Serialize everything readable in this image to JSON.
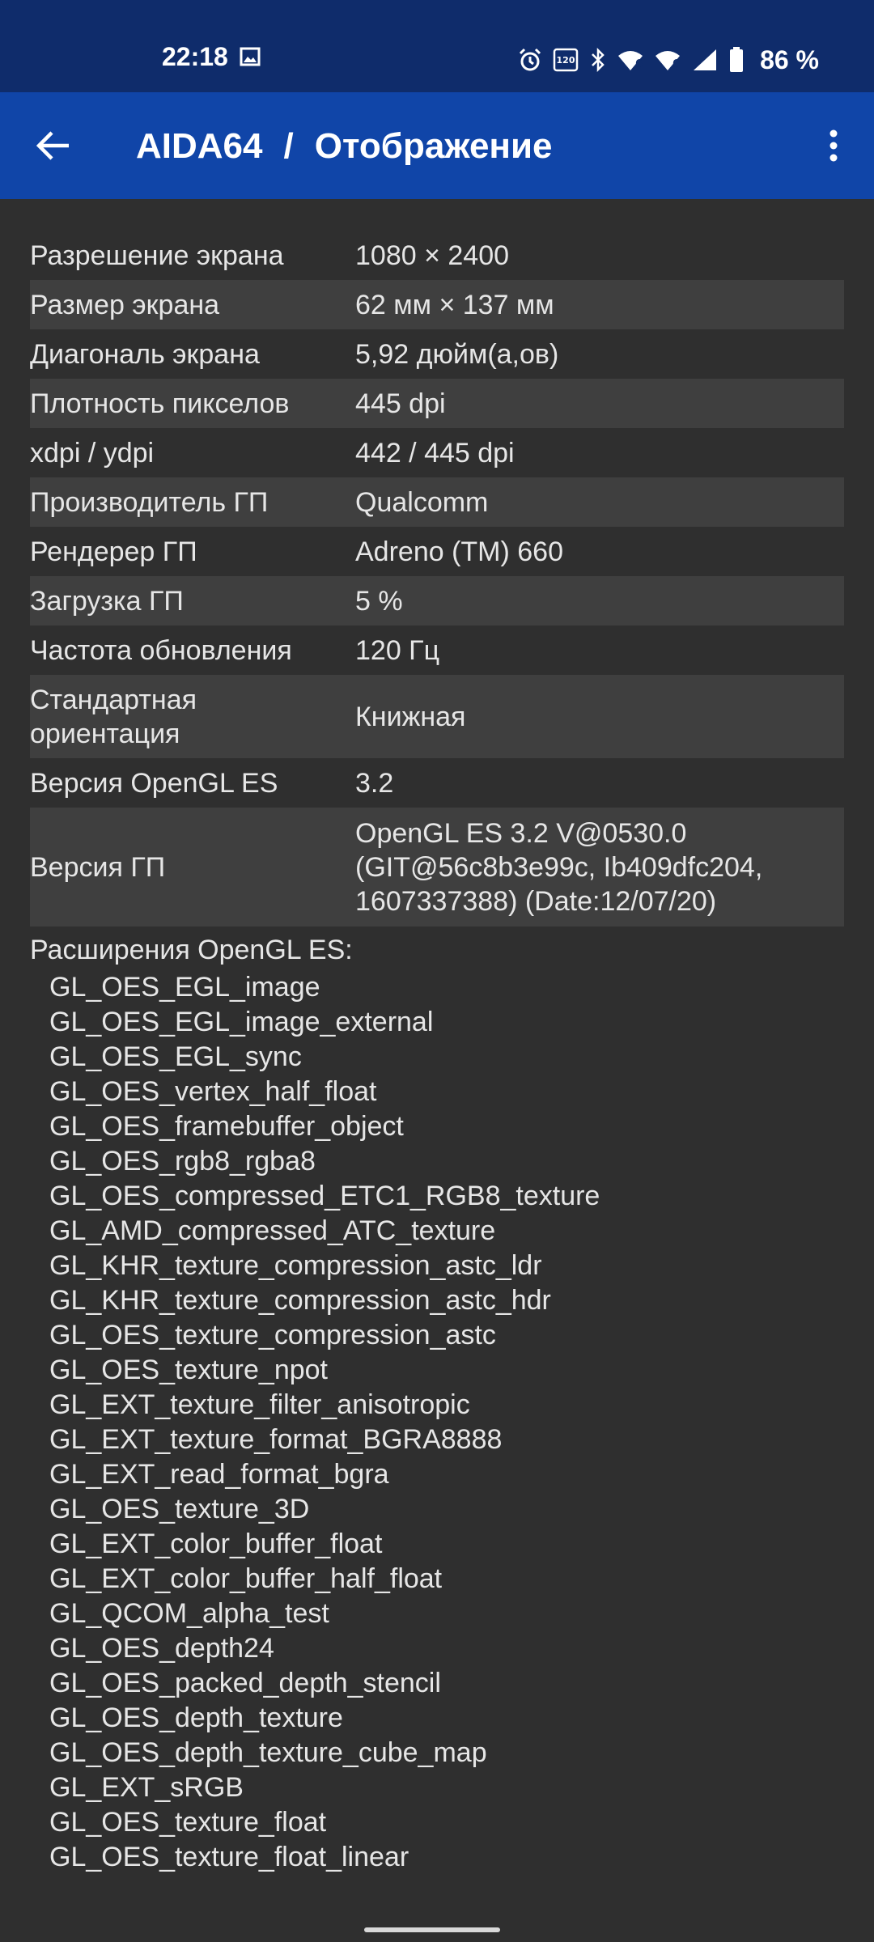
{
  "status_bar": {
    "time": "22:18",
    "battery_percent": "86 %",
    "refresh_badge": "120",
    "icons": [
      "image-icon",
      "alarm-icon",
      "refresh-rate-icon",
      "bluetooth-icon",
      "wifi-6-icon",
      "wifi-6-icon",
      "signal-icon",
      "battery-icon"
    ]
  },
  "app_bar": {
    "app_name": "AIDA64",
    "separator": "/",
    "page_title": "Отображение",
    "back_icon": "arrow-back-icon",
    "menu_icon": "more-vert-icon"
  },
  "rows": [
    {
      "label": "Разрешение экрана",
      "value": "1080 × 2400"
    },
    {
      "label": "Размер экрана",
      "value": "62 мм × 137 мм"
    },
    {
      "label": "Диагональ экрана",
      "value": "5,92 дюйм(а,ов)"
    },
    {
      "label": "Плотность пикселов",
      "value": "445 dpi"
    },
    {
      "label": "xdpi / ydpi",
      "value": "442 / 445 dpi"
    },
    {
      "label": "Производитель ГП",
      "value": "Qualcomm"
    },
    {
      "label": "Рендерер ГП",
      "value": "Adreno (TM) 660"
    },
    {
      "label": "Загрузка ГП",
      "value": "5 %"
    },
    {
      "label": "Частота обновления",
      "value": "120 Гц"
    },
    {
      "label": "Стандартная ориентация",
      "value": "Книжная"
    },
    {
      "label": "Версия OpenGL ES",
      "value": "3.2"
    },
    {
      "label": "Версия ГП",
      "value": "OpenGL ES 3.2 V@0530.0 (GIT@56c8b3e99c, Ib409dfc204, 1607337388) (Date:12/07/20)"
    }
  ],
  "extensions": {
    "title": "Расширения OpenGL ES:",
    "items": [
      "GL_OES_EGL_image",
      "GL_OES_EGL_image_external",
      "GL_OES_EGL_sync",
      "GL_OES_vertex_half_float",
      "GL_OES_framebuffer_object",
      "GL_OES_rgb8_rgba8",
      "GL_OES_compressed_ETC1_RGB8_texture",
      "GL_AMD_compressed_ATC_texture",
      "GL_KHR_texture_compression_astc_ldr",
      "GL_KHR_texture_compression_astc_hdr",
      "GL_OES_texture_compression_astc",
      "GL_OES_texture_npot",
      "GL_EXT_texture_filter_anisotropic",
      "GL_EXT_texture_format_BGRA8888",
      "GL_EXT_read_format_bgra",
      "GL_OES_texture_3D",
      "GL_EXT_color_buffer_float",
      "GL_EXT_color_buffer_half_float",
      "GL_QCOM_alpha_test",
      "GL_OES_depth24",
      "GL_OES_packed_depth_stencil",
      "GL_OES_depth_texture",
      "GL_OES_depth_texture_cube_map",
      "GL_EXT_sRGB",
      "GL_OES_texture_float",
      "GL_OES_texture_float_linear"
    ]
  },
  "colors": {
    "status_bar": "#0f2c6b",
    "app_bar": "#1045a8",
    "background": "#2f2f2f",
    "alt_row": "#3f3f3f",
    "text": "#e6e6e6"
  }
}
